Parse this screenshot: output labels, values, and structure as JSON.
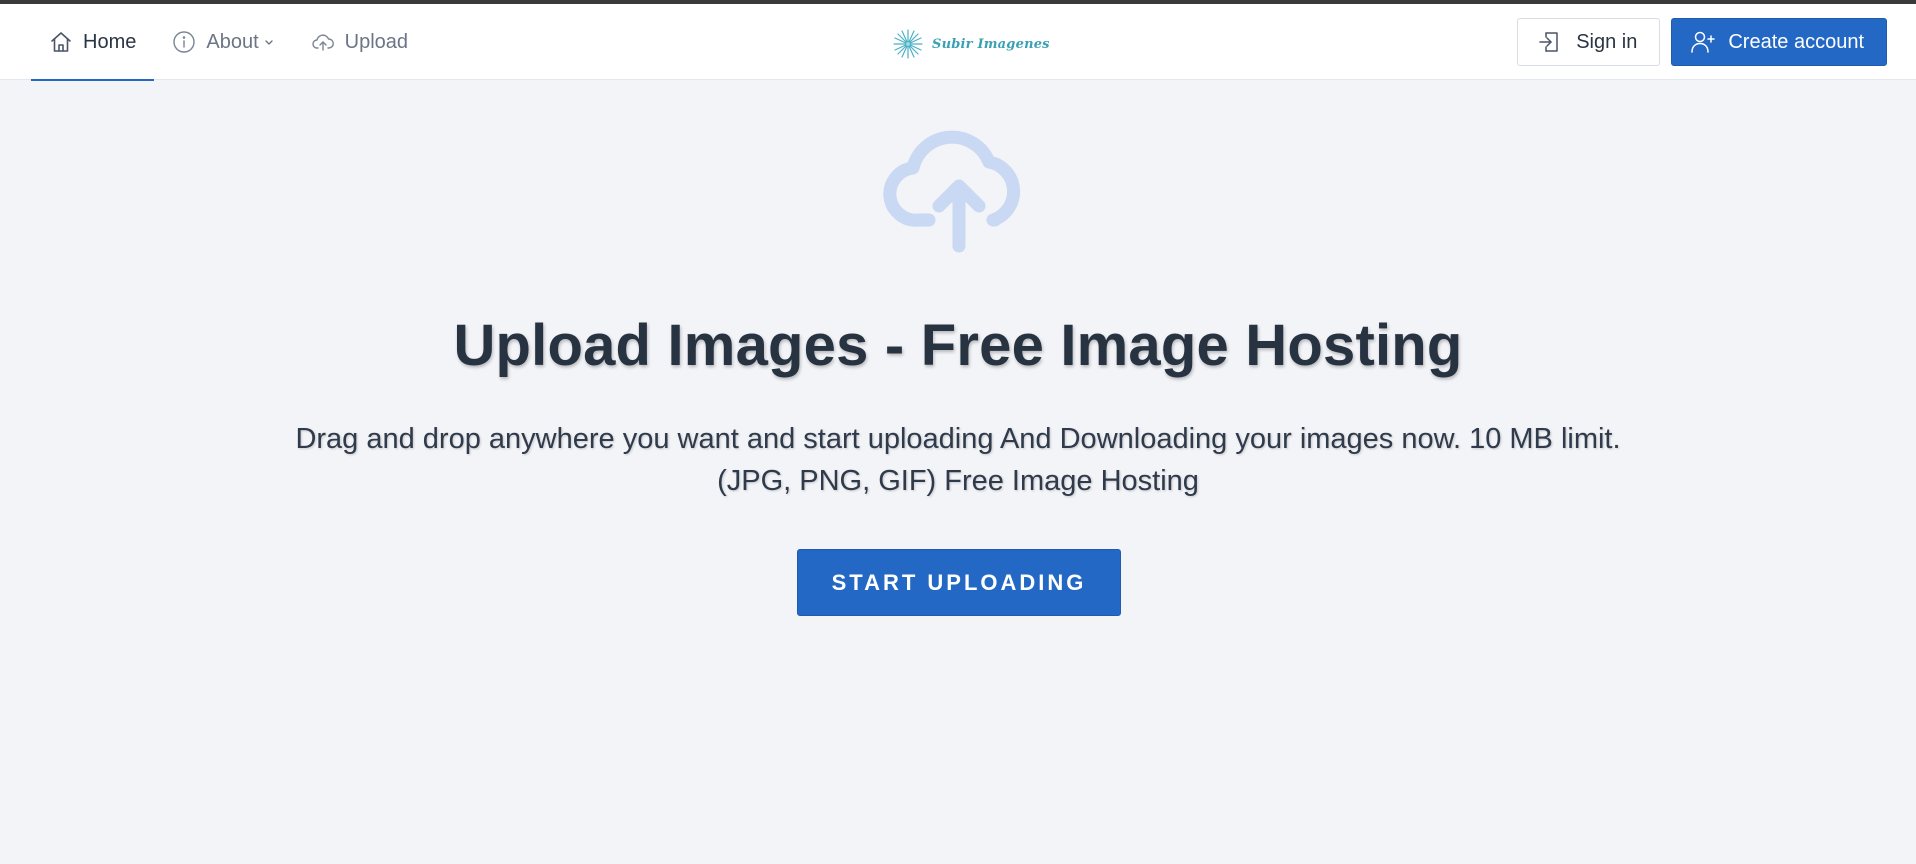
{
  "nav": {
    "items": [
      {
        "label": "Home",
        "icon": "home-icon",
        "active": true
      },
      {
        "label": "About",
        "icon": "info-icon",
        "active": false
      },
      {
        "label": "Upload",
        "icon": "cloud-upload-icon",
        "active": false
      }
    ]
  },
  "brand": {
    "logo_text": "Subir Imagenes"
  },
  "auth": {
    "signin_label": "Sign in",
    "create_label": "Create account"
  },
  "hero": {
    "title": "Upload Images - Free Image Hosting",
    "description_line1": "Drag and drop anywhere you want and start uploading And Downloading your images now. 10 MB limit.",
    "description_line2": "(JPG, PNG, GIF) Free Image Hosting",
    "cta_label": "START UPLOADING"
  },
  "colors": {
    "accent": "#2468c5",
    "background": "#f3f4f8",
    "cloud": "#c9d8f3",
    "logo": "#3aa1b5"
  }
}
